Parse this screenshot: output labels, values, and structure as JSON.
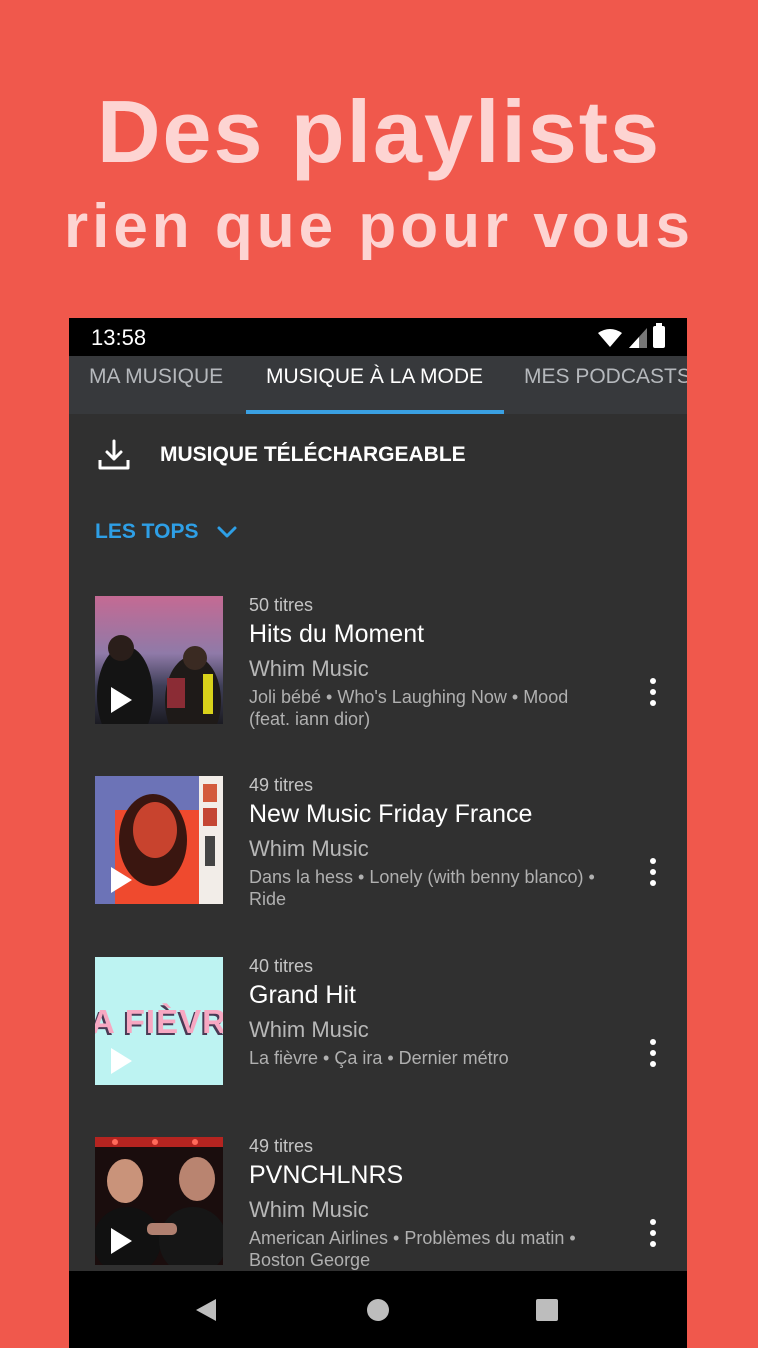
{
  "hero": {
    "title": "Des playlists",
    "subtitle": "rien que pour vous"
  },
  "status_bar": {
    "time": "13:58",
    "icons": [
      "wifi-icon",
      "signal-icon",
      "battery-icon"
    ]
  },
  "tabs": [
    {
      "label": "MA MUSIQUE",
      "active": false
    },
    {
      "label": "MUSIQUE À LA MODE",
      "active": true
    },
    {
      "label": "MES PODCASTS",
      "active": false
    }
  ],
  "download": {
    "label": "MUSIQUE TÉLÉCHARGEABLE",
    "icon": "download-icon"
  },
  "filter": {
    "label": "LES TOPS",
    "icon": "chevron-down-icon"
  },
  "playlists": [
    {
      "count": "50 titres",
      "title": "Hits du Moment",
      "owner": "Whim Music",
      "tracks": "Joli bébé • Who's Laughing Now • Mood (feat. iann dior)"
    },
    {
      "count": "49 titres",
      "title": "New Music Friday France",
      "owner": "Whim Music",
      "tracks": "Dans la hess • Lonely (with benny blanco) • Ride"
    },
    {
      "count": "40 titres",
      "title": "Grand Hit",
      "owner": "Whim Music",
      "tracks": "La fièvre • Ça ira • Dernier métro",
      "cover_text": "A FIÈVR"
    },
    {
      "count": "49 titres",
      "title": "PVNCHLNRS",
      "owner": "Whim Music",
      "tracks": "American Airlines • Problèmes du matin • Boston George"
    }
  ],
  "colors": {
    "background": "#f0584c",
    "hero_text": "#fdd4d2",
    "accent": "#2e9fe6",
    "app_background": "#303030"
  }
}
